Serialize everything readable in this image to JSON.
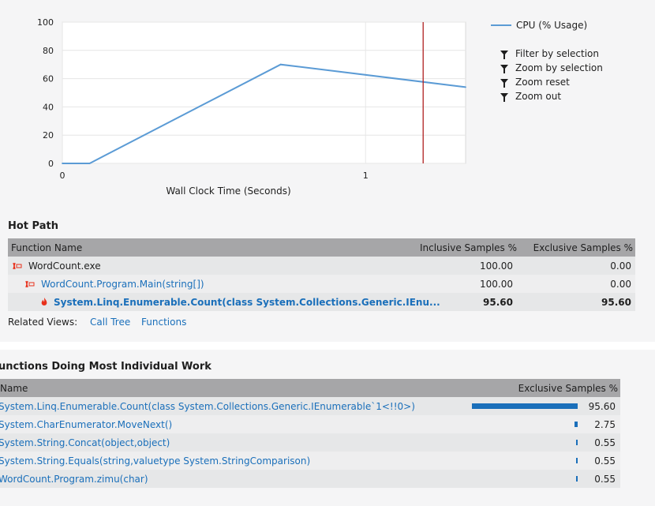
{
  "chart_data": {
    "type": "line",
    "series": [
      {
        "name": "CPU (% Usage)",
        "x": [
          0,
          0.09,
          0.72,
          1.33
        ],
        "y": [
          0,
          0,
          70,
          54
        ]
      }
    ],
    "xlabel": "Wall Clock Time (Seconds)",
    "ylabel": "",
    "xlim": [
      0,
      1.33
    ],
    "ylim": [
      0,
      100
    ],
    "x_ticks": [
      0,
      1
    ],
    "y_ticks": [
      0,
      20,
      40,
      60,
      80,
      100
    ],
    "x_tick_labels": [
      "0",
      "1"
    ],
    "y_tick_labels": [
      "0",
      "20",
      "40",
      "60",
      "80",
      "100"
    ],
    "marker_x": 1.19,
    "grid": true,
    "legend": "right",
    "line_color": "#5b9bd5",
    "marker_color": "#b02020"
  },
  "legend": {
    "label": "CPU (% Usage)"
  },
  "chart_menu": [
    "Filter by selection",
    "Zoom by selection",
    "Zoom reset",
    "Zoom out"
  ],
  "hot_path": {
    "title": "Hot Path",
    "headers": {
      "name": "Function Name",
      "inclusive": "Inclusive Samples %",
      "exclusive": "Exclusive Samples %"
    },
    "rows": [
      {
        "name": "WordCount.exe",
        "inclusive": "100.00",
        "exclusive": "0.00"
      },
      {
        "name": "WordCount.Program.Main(string[])",
        "inclusive": "100.00",
        "exclusive": "0.00"
      },
      {
        "name": "System.Linq.Enumerable.Count(class System.Collections.Generic.IEnu...",
        "inclusive": "95.60",
        "exclusive": "95.60"
      }
    ]
  },
  "related_views": {
    "label": "Related Views:",
    "call_tree": "Call Tree",
    "functions": "Functions"
  },
  "individual_work": {
    "title": "unctions Doing Most Individual Work",
    "headers": {
      "name": "Name",
      "exclusive": "Exclusive Samples %"
    },
    "rows": [
      {
        "name": "System.Linq.Enumerable.Count(class System.Collections.Generic.IEnumerable`1<!!0>)",
        "value": "95.60",
        "fraction": 0.956
      },
      {
        "name": "System.CharEnumerator.MoveNext()",
        "value": "2.75",
        "fraction": 0.0275
      },
      {
        "name": "System.String.Concat(object,object)",
        "value": "0.55",
        "fraction": 0.0055
      },
      {
        "name": "System.String.Equals(string,valuetype System.StringComparison)",
        "value": "0.55",
        "fraction": 0.0055
      },
      {
        "name": "WordCount.Program.zimu(char)",
        "value": "0.55",
        "fraction": 0.0055
      }
    ]
  },
  "colors": {
    "link": "#1a6fba",
    "header_bg": "#a6a6a8",
    "row_bg": "#e6e7e8",
    "hot_icon": "#e8311c"
  }
}
